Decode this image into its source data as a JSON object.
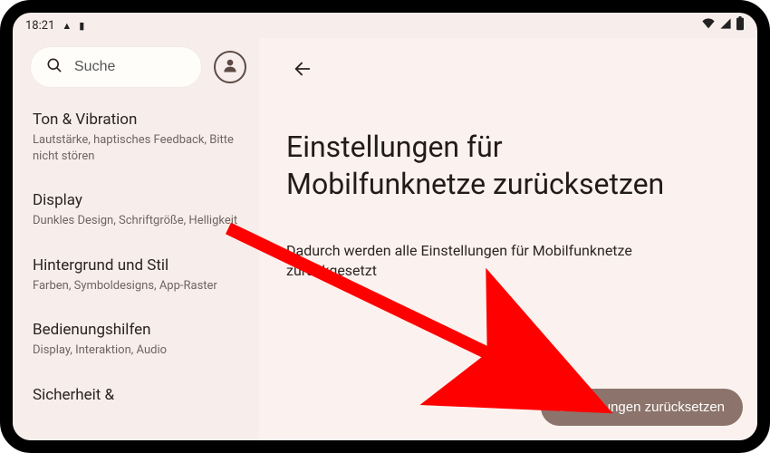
{
  "status": {
    "time": "18:21",
    "wifi_icon": "wifi",
    "signal_icon": "signal",
    "battery_icon": "battery"
  },
  "sidebar": {
    "search_placeholder": "Suche",
    "items": [
      {
        "title": "Ton & Vibration",
        "subtitle": "Lautstärke, haptisches Feedback, Bitte nicht stören"
      },
      {
        "title": "Display",
        "subtitle": "Dunkles Design, Schriftgröße, Helligkeit"
      },
      {
        "title": "Hintergrund und Stil",
        "subtitle": "Farben, Symboldesigns, App-Raster"
      },
      {
        "title": "Bedienungshilfen",
        "subtitle": "Display, Interaktion, Audio"
      },
      {
        "title": "Sicherheit &",
        "subtitle": ""
      }
    ]
  },
  "main": {
    "title": "Einstellungen für Mobilfunknetze zurücksetzen",
    "description": "Dadurch werden alle Einstellungen für Mobilfunknetze zurückgesetzt",
    "reset_button": "Einstellungen zurücksetzen"
  },
  "colors": {
    "accent": "#8c746c",
    "annotation": "#ff0000"
  }
}
